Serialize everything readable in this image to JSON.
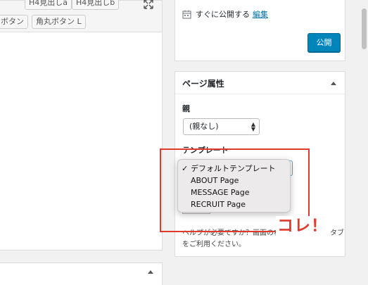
{
  "editor": {
    "toolbar": {
      "buttons": [
        "H4見出しa",
        "H4見出しb",
        "ボタン",
        "角丸ボタン L"
      ]
    },
    "fullscreen_icon": "fullscreen-icon"
  },
  "publish": {
    "schedule_text": "すぐに公開する",
    "schedule_edit": "編集",
    "publish_button": "公開",
    "calendar_icon": "calendar-icon"
  },
  "page_attributes": {
    "title": "ページ属性",
    "parent_label": "親",
    "parent_value": "(親なし)",
    "template_label": "テンプレート",
    "template_options": [
      "デフォルトテンプレート",
      "ABOUT Page",
      "MESSAGE Page",
      "RECRUIT Page"
    ],
    "template_selected_index": 0,
    "help_text": "ヘルプが必要ですか？画面の右上の「ヘルプ」タブをご利用ください。"
  },
  "annotation": {
    "label": "コレ！",
    "color": "#e03a2c"
  },
  "colors": {
    "accent": "#0085ba",
    "link": "#0073aa"
  }
}
